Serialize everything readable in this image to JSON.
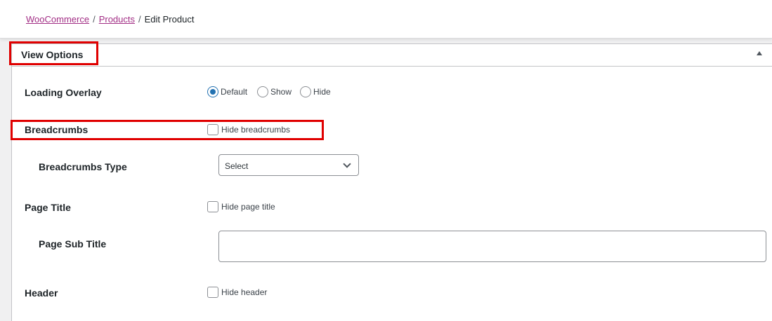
{
  "breadcrumb": {
    "root": "WooCommerce",
    "section": "Products",
    "current": "Edit Product",
    "separator": "/"
  },
  "panel": {
    "title": "View Options"
  },
  "fields": {
    "loading_overlay": {
      "label": "Loading Overlay",
      "options": [
        "Default",
        "Show",
        "Hide"
      ],
      "selected": "Default"
    },
    "breadcrumbs": {
      "label": "Breadcrumbs",
      "checkbox_label": "Hide breadcrumbs",
      "checked": false
    },
    "breadcrumbs_type": {
      "label": "Breadcrumbs Type",
      "value": "Select"
    },
    "page_title": {
      "label": "Page Title",
      "checkbox_label": "Hide page title",
      "checked": false
    },
    "page_sub_title": {
      "label": "Page Sub Title",
      "value": ""
    },
    "header": {
      "label": "Header",
      "checkbox_label": "Hide header",
      "checked": false
    }
  },
  "colors": {
    "link": "#a22e85",
    "accent": "#2271b1",
    "highlight": "#e00000"
  }
}
